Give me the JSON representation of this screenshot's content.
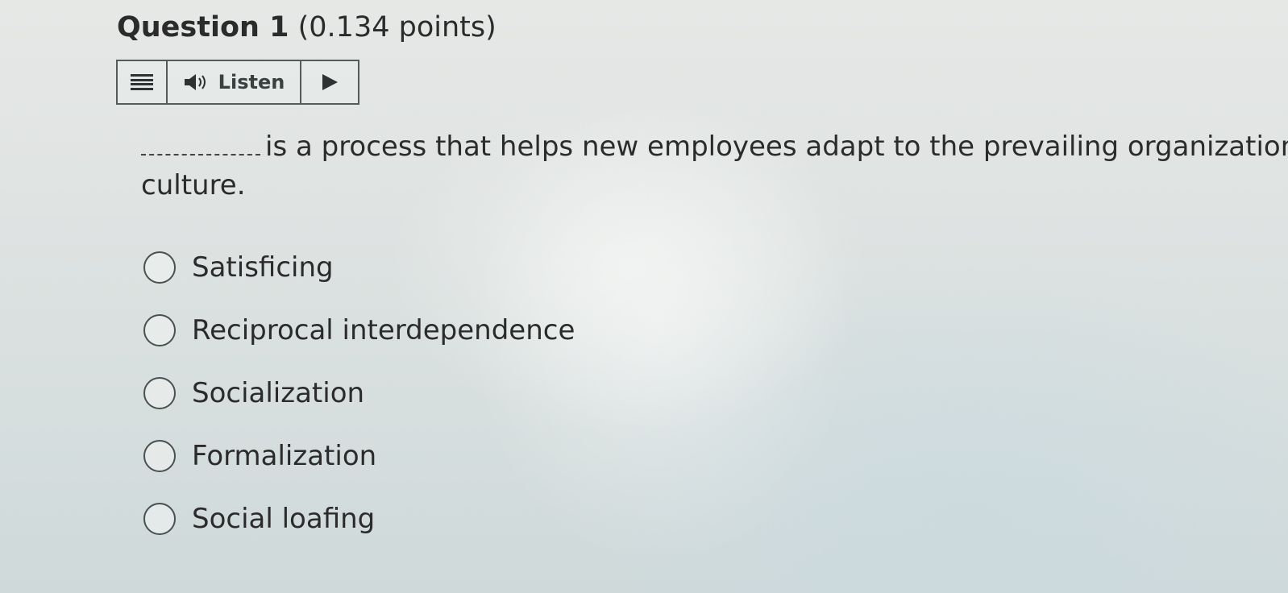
{
  "question": {
    "label": "Question 1",
    "points": "(0.134 points)",
    "text_line1": "is a process that helps new employees adapt to the prevailing organization",
    "text_line2": "culture."
  },
  "listen_bar": {
    "menu_icon": "hamburger-menu-icon",
    "speaker_icon": "speaker-icon",
    "listen_label": "Listen",
    "play_icon": "play-icon"
  },
  "options": [
    {
      "label": "Satisficing",
      "selected": false
    },
    {
      "label": "Reciprocal interdependence",
      "selected": false
    },
    {
      "label": "Socialization",
      "selected": false
    },
    {
      "label": "Formalization",
      "selected": false
    },
    {
      "label": "Social loafing",
      "selected": false
    }
  ],
  "colors": {
    "text": "#2b2b2b",
    "border": "#555a5a"
  }
}
